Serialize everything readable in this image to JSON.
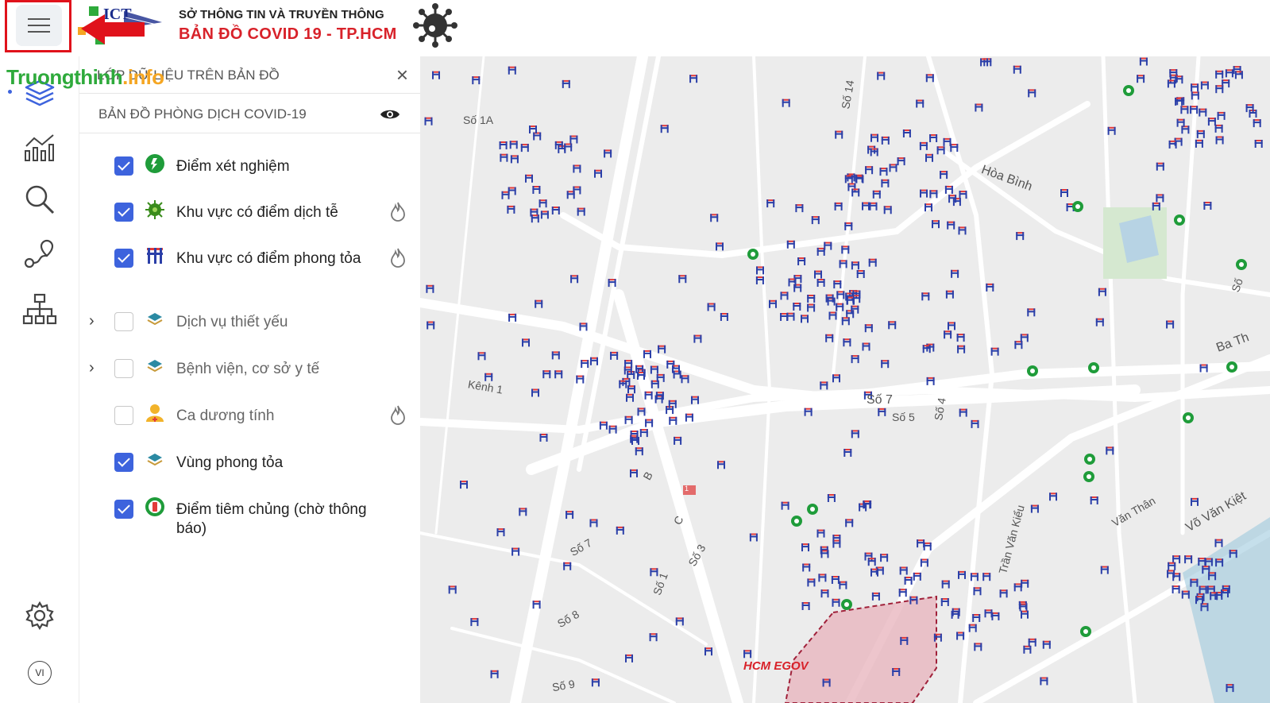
{
  "header": {
    "org_line": "SỞ THÔNG TIN VÀ TRUYỀN THÔNG",
    "app_title": "BẢN ĐỒ  COVID 19 - TP.HCM",
    "logo_text": "ICT",
    "menu_icon": "hamburger-icon",
    "annotation_arrow_color": "#e0121b"
  },
  "watermark": {
    "main": "Truongthinh",
    "suffix": ".info"
  },
  "rail": {
    "items": [
      "layers-icon",
      "chart-icon",
      "search-icon",
      "route-icon",
      "sitemap-icon"
    ],
    "settings_icon": "gear-icon",
    "language": "VI"
  },
  "panel": {
    "title": "LỚP DỮ LIỆU TRÊN BẢN ĐỒ",
    "close_label": "×",
    "group_title": "BẢN ĐỒ PHÒNG DỊCH COVID-19",
    "layers": [
      {
        "label": "Điểm xét nghiệm",
        "checked": true,
        "icon": "test-site-icon"
      },
      {
        "label": "Khu vực có điểm dịch tễ",
        "checked": true,
        "icon": "virus-icon"
      },
      {
        "label": "Khu vực có điểm phong tỏa",
        "checked": true,
        "icon": "lockdown-barrier-icon"
      },
      {
        "label": "Dịch vụ thiết yếu",
        "checked": false,
        "icon": "stack-icon"
      },
      {
        "label": "Bệnh viện, cơ sở y tế",
        "checked": false,
        "icon": "stack-icon"
      },
      {
        "label": "Ca dương tính",
        "checked": false,
        "icon": "positive-case-icon"
      },
      {
        "label": "Vùng phong tỏa",
        "checked": true,
        "icon": "stack-icon"
      },
      {
        "label": "Điểm tiêm chủng (chờ thông báo)",
        "checked": true,
        "icon": "vaccination-icon"
      }
    ]
  },
  "map": {
    "road_labels": [
      "Số 1A",
      "Số 14",
      "Hòa Bình",
      "Kênh 1",
      "Số 7",
      "Số 5",
      "Số 4",
      "Ba Th",
      "B",
      "C",
      "Số 7",
      "Số 3",
      "Số 1",
      "Số 8",
      "Số 9",
      "Trần Văn Kiểu",
      "Văn Thân",
      "Võ Văn Kiệt",
      "Số"
    ],
    "highway_shield": "1",
    "brand": "HCM EGOV",
    "colors": {
      "background": "#ececec",
      "road": "#ffffff",
      "marker": "#2b3fa8",
      "marker_accent": "#e23a3a",
      "test_site": "#1f9c3a",
      "zone_fill": "#e8b7bf",
      "zone_border": "#a0213a"
    }
  }
}
